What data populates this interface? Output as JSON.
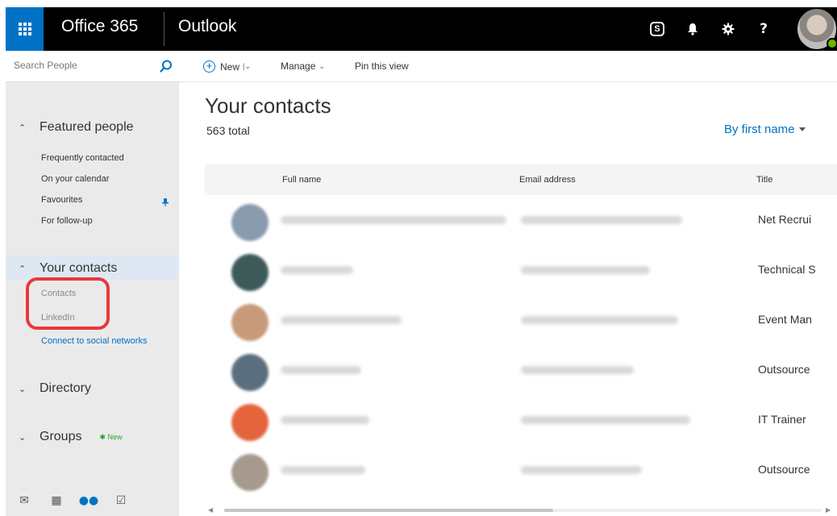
{
  "topbar": {
    "suite": "Office 365",
    "app": "Outlook",
    "icons": [
      "waffle-icon",
      "skype-icon",
      "bell-icon",
      "gear-icon",
      "help-icon"
    ],
    "skype_glyph": "S",
    "help_glyph": "?",
    "accent": "#0072c6"
  },
  "search": {
    "placeholder": "Search People"
  },
  "commands": {
    "new_label": "New",
    "manage_label": "Manage",
    "pin_label": "Pin this view"
  },
  "leftnav": {
    "featured": {
      "label": "Featured people",
      "items": [
        "Frequently contacted",
        "On your calendar",
        "Favourites",
        "For follow-up"
      ]
    },
    "your_contacts": {
      "label": "Your contacts",
      "items": [
        "Contacts",
        "LinkedIn"
      ],
      "link": "Connect to social networks"
    },
    "directory": {
      "label": "Directory"
    },
    "groups": {
      "label": "Groups",
      "badge": "New"
    }
  },
  "main": {
    "title": "Your contacts",
    "total": "563 total",
    "sort": "By first name",
    "columns": {
      "full_name": "Full name",
      "email": "Email address",
      "title": "Title"
    },
    "contacts": [
      {
        "title": "Net Recrui",
        "avatar_color": "#8a9bb0"
      },
      {
        "title": "Technical S",
        "avatar_color": "#3d5a5a"
      },
      {
        "title": "Event Man",
        "avatar_color": "#c79b7a"
      },
      {
        "title": "Outsource",
        "avatar_color": "#5b6e80"
      },
      {
        "title": "IT Trainer",
        "avatar_color": "#e4643c"
      },
      {
        "title": "Outsource",
        "avatar_color": "#a69a8f"
      }
    ]
  }
}
